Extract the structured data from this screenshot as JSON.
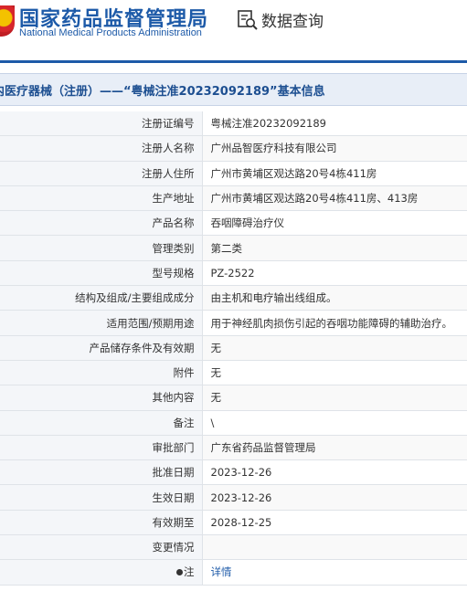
{
  "header": {
    "org_name_cn": "国家药品监督管理局",
    "org_name_en": "National Medical Products Administration",
    "search_label": "数据查询"
  },
  "title": "内医疗器械（注册）——“粤械注准20232092189”基本信息",
  "rows": [
    {
      "label": "注册证编号",
      "value": "粤械注准20232092189"
    },
    {
      "label": "注册人名称",
      "value": "广州品智医疗科技有限公司"
    },
    {
      "label": "注册人住所",
      "value": "广州市黄埔区观达路20号4栋411房"
    },
    {
      "label": "生产地址",
      "value": "广州市黄埔区观达路20号4栋411房、413房"
    },
    {
      "label": "产品名称",
      "value": "吞咽障碍治疗仪"
    },
    {
      "label": "管理类别",
      "value": "第二类"
    },
    {
      "label": "型号规格",
      "value": "PZ-2522"
    },
    {
      "label": "结构及组成/主要组成成分",
      "value": "由主机和电疗输出线组成。"
    },
    {
      "label": "适用范围/预期用途",
      "value": "用于神经肌肉损伤引起的吞咽功能障碍的辅助治疗。"
    },
    {
      "label": "产品储存条件及有效期",
      "value": "无"
    },
    {
      "label": "附件",
      "value": "无"
    },
    {
      "label": "其他内容",
      "value": "无"
    },
    {
      "label": "备注",
      "value": "\\"
    },
    {
      "label": "审批部门",
      "value": "广东省药品监督管理局"
    },
    {
      "label": "批准日期",
      "value": "2023-12-26"
    },
    {
      "label": "生效日期",
      "value": "2023-12-26"
    },
    {
      "label": "有效期至",
      "value": "2028-12-25"
    },
    {
      "label": "变更情况",
      "value": ""
    },
    {
      "label": "注",
      "value": "详情"
    }
  ],
  "colors": {
    "brand_blue": "#1d5aa8",
    "title_bar_bg": "#e8eef7"
  }
}
